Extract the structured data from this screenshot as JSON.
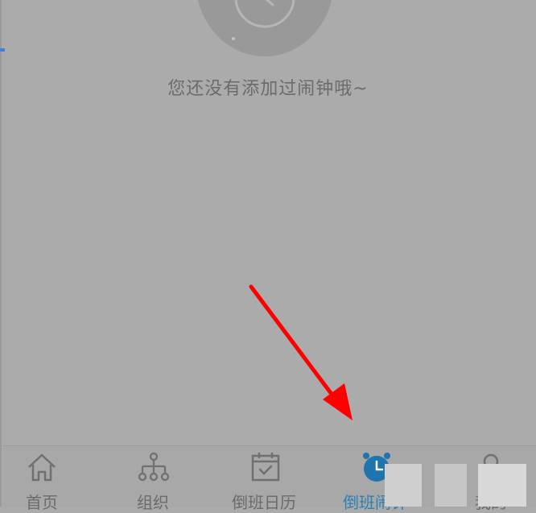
{
  "empty_state": {
    "message": "您还没有添加过闹钟哦~",
    "icon": "alarm-clock-icon"
  },
  "tabbar": {
    "items": [
      {
        "label": "首页",
        "icon": "home-icon"
      },
      {
        "label": "组织",
        "icon": "org-chart-icon"
      },
      {
        "label": "倒班日历",
        "icon": "calendar-check-icon"
      },
      {
        "label": "倒班闹钟",
        "icon": "alarm-clock-icon",
        "active": true
      },
      {
        "label": "我的",
        "icon": "user-icon"
      }
    ]
  },
  "colors": {
    "overlay": "#ababab",
    "accent": "#2d7fb5",
    "annotation_arrow": "#ff0000",
    "muted_text": "#6b6b6b"
  }
}
